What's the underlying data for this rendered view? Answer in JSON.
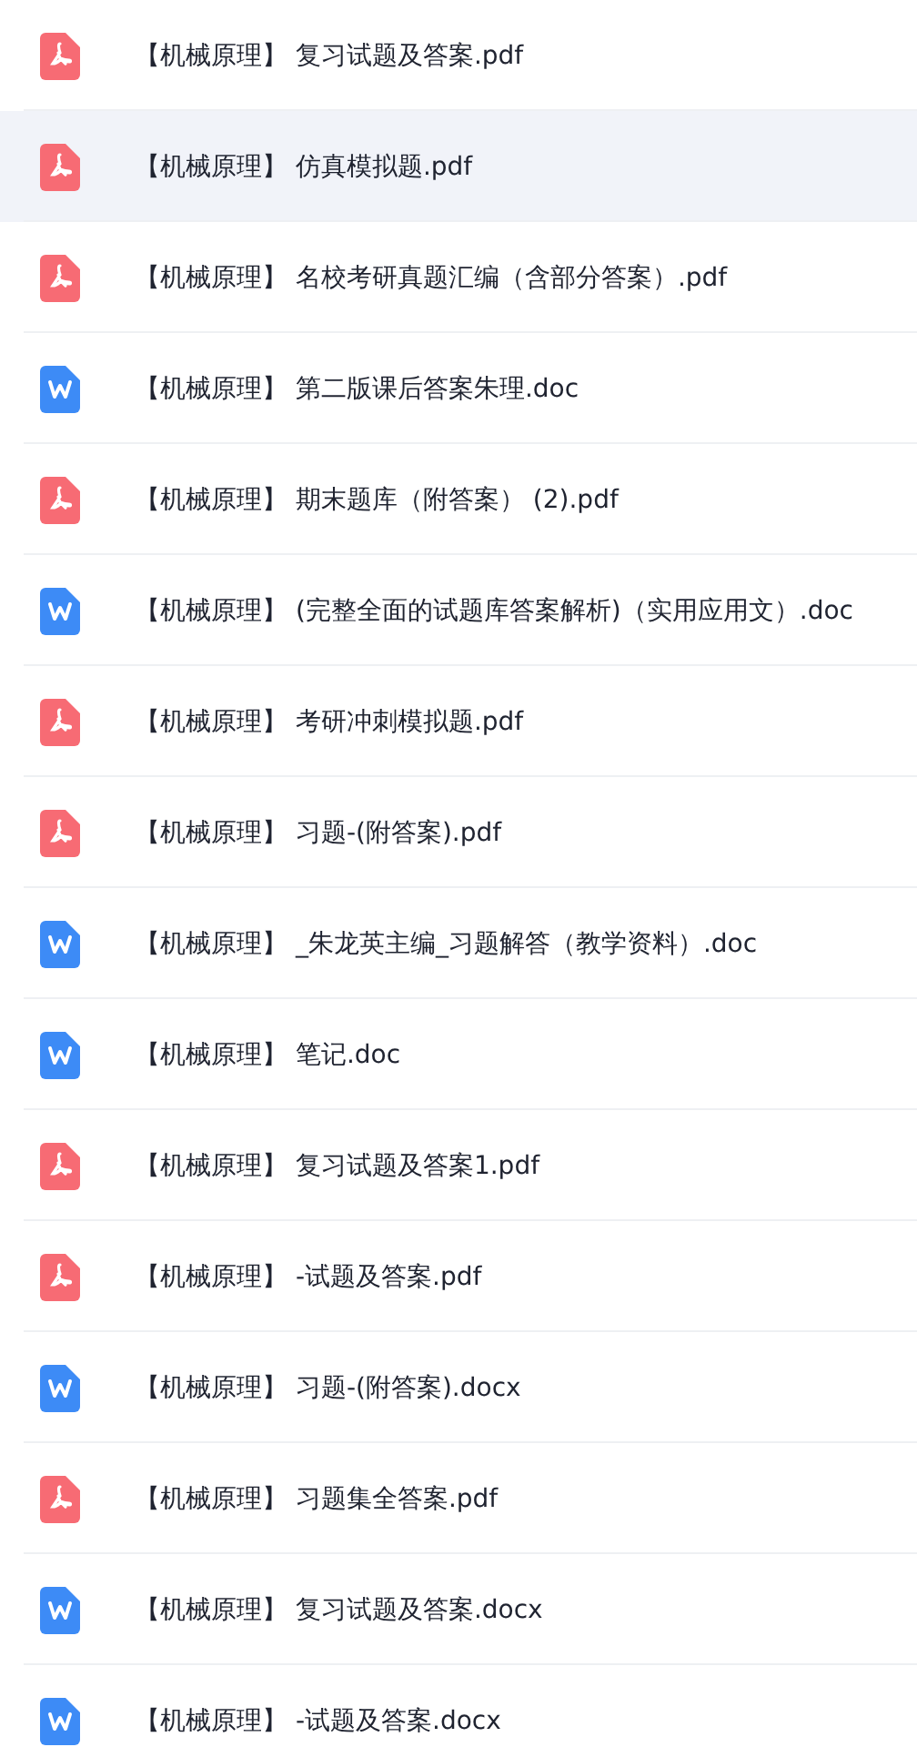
{
  "files": [
    {
      "kind": "pdf",
      "name": "【机械原理】 复习试题及答案.pdf",
      "selected": false
    },
    {
      "kind": "pdf",
      "name": "【机械原理】 仿真模拟题.pdf",
      "selected": true
    },
    {
      "kind": "pdf",
      "name": "【机械原理】 名校考研真题汇编（含部分答案）.pdf",
      "selected": false
    },
    {
      "kind": "word",
      "name": "【机械原理】 第二版课后答案朱理.doc",
      "selected": false
    },
    {
      "kind": "pdf",
      "name": "【机械原理】 期末题库（附答案） (2).pdf",
      "selected": false
    },
    {
      "kind": "word",
      "name": "【机械原理】 (完整全面的试题库答案解析)（实用应用文）.doc",
      "selected": false
    },
    {
      "kind": "pdf",
      "name": "【机械原理】 考研冲刺模拟题.pdf",
      "selected": false
    },
    {
      "kind": "pdf",
      "name": "【机械原理】 习题-(附答案).pdf",
      "selected": false
    },
    {
      "kind": "word",
      "name": "【机械原理】 _朱龙英主编_习题解答（教学资料）.doc",
      "selected": false
    },
    {
      "kind": "word",
      "name": "【机械原理】 笔记.doc",
      "selected": false
    },
    {
      "kind": "pdf",
      "name": "【机械原理】 复习试题及答案1.pdf",
      "selected": false
    },
    {
      "kind": "pdf",
      "name": "【机械原理】 -试题及答案.pdf",
      "selected": false
    },
    {
      "kind": "word",
      "name": "【机械原理】 习题-(附答案).docx",
      "selected": false
    },
    {
      "kind": "pdf",
      "name": "【机械原理】 习题集全答案.pdf",
      "selected": false
    },
    {
      "kind": "word",
      "name": "【机械原理】 复习试题及答案.docx",
      "selected": false
    },
    {
      "kind": "word",
      "name": "【机械原理】 -试题及答案.docx",
      "selected": false
    }
  ]
}
